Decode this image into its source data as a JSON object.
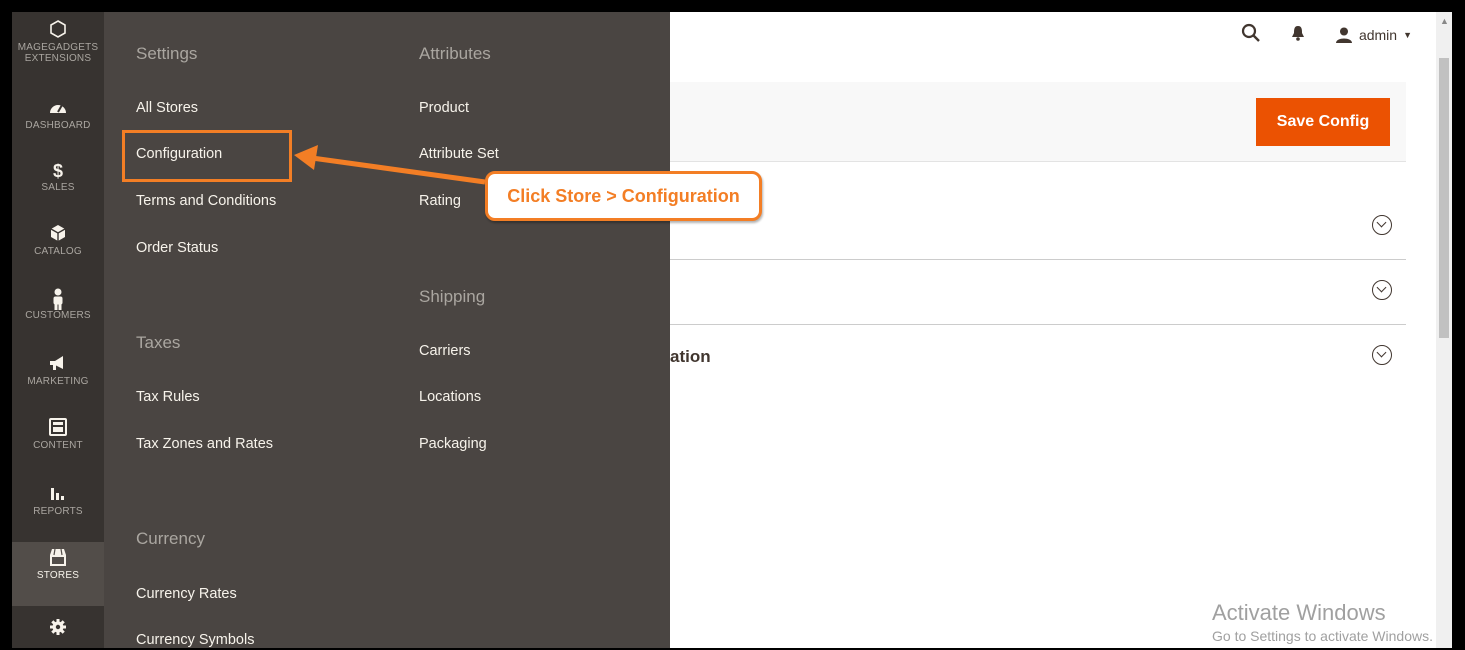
{
  "sidebar": {
    "items": [
      {
        "label": "MAGEGADGETS\nEXTENSIONS",
        "icon": "hexagon-icon"
      },
      {
        "label": "DASHBOARD",
        "icon": "dashboard-icon"
      },
      {
        "label": "SALES",
        "icon": "dollar-icon"
      },
      {
        "label": "CATALOG",
        "icon": "box-icon"
      },
      {
        "label": "CUSTOMERS",
        "icon": "person-icon"
      },
      {
        "label": "MARKETING",
        "icon": "megaphone-icon"
      },
      {
        "label": "CONTENT",
        "icon": "layout-icon"
      },
      {
        "label": "REPORTS",
        "icon": "bar-chart-icon"
      },
      {
        "label": "STORES",
        "icon": "store-icon"
      },
      {
        "label": "",
        "icon": "gear-icon"
      }
    ]
  },
  "flyout": {
    "col1": {
      "settings_title": "Settings",
      "settings_links": [
        "All Stores",
        "Configuration",
        "Terms and Conditions",
        "Order Status"
      ],
      "taxes_title": "Taxes",
      "taxes_links": [
        "Tax Rules",
        "Tax Zones and Rates"
      ],
      "currency_title": "Currency",
      "currency_links": [
        "Currency Rates",
        "Currency Symbols"
      ]
    },
    "col2": {
      "attributes_title": "Attributes",
      "attributes_links": [
        "Product",
        "Attribute Set",
        "Rating"
      ],
      "shipping_title": "Shipping",
      "shipping_links": [
        "Carriers",
        "Locations",
        "Packaging"
      ]
    }
  },
  "header": {
    "user_label": "admin"
  },
  "main": {
    "save_label": "Save Config",
    "section_fragment": "ation"
  },
  "annotation": {
    "callout_text": "Click Store > Configuration"
  },
  "watermark": {
    "title": "Activate Windows",
    "subtitle": "Go to Settings to activate Windows."
  },
  "colors": {
    "accent": "#eb5202",
    "annotation": "#f37e25",
    "sidebar": "#373330",
    "flyout": "#4a4542"
  }
}
